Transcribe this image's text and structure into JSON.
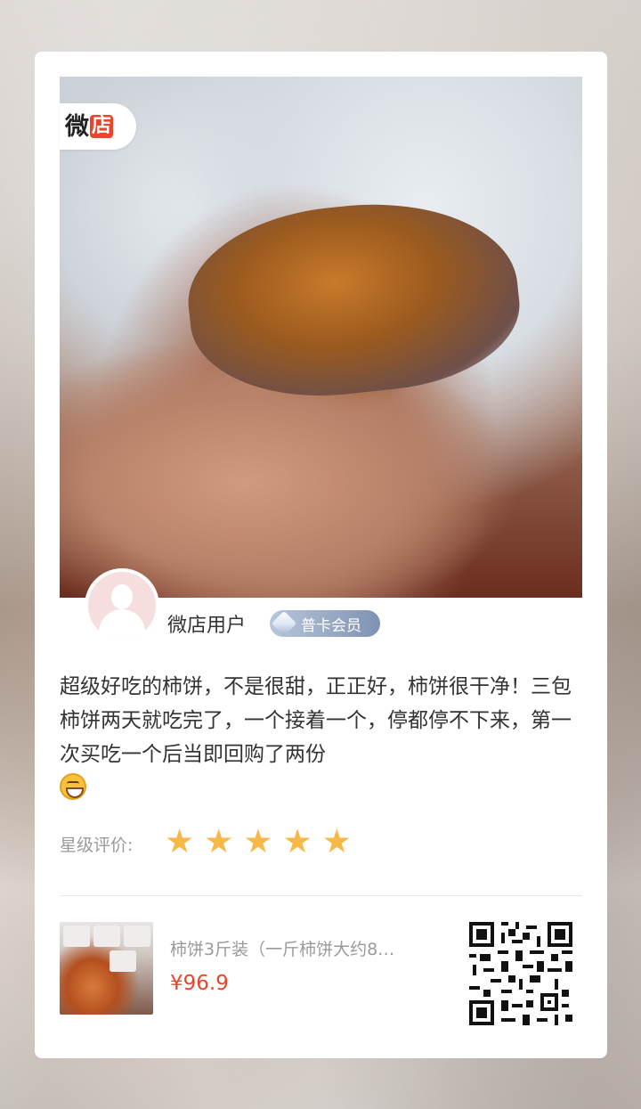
{
  "brand": {
    "logo_part1": "微",
    "logo_part2": "店"
  },
  "user": {
    "name": "微店用户",
    "member_badge": "普卡会员"
  },
  "review": {
    "text": "超级好吃的柿饼，不是很甜，正正好，柿饼很干净！三包柿饼两天就吃完了，一个接着一个，停都停不下来，第一次买吃一个后当即回购了两份",
    "emoji": "grinning-face"
  },
  "rating": {
    "label": "星级评价:",
    "stars": 5,
    "max_stars": 5,
    "star_color": "#f7b84a"
  },
  "product": {
    "title": "柿饼3斤装（一斤柿饼大约8…",
    "price": "¥96.9",
    "price_color": "#e8452b"
  },
  "colors": {
    "accent_red": "#e8452b",
    "member_badge_blue": "#7d92b3",
    "avatar_pink": "#f6dede"
  }
}
